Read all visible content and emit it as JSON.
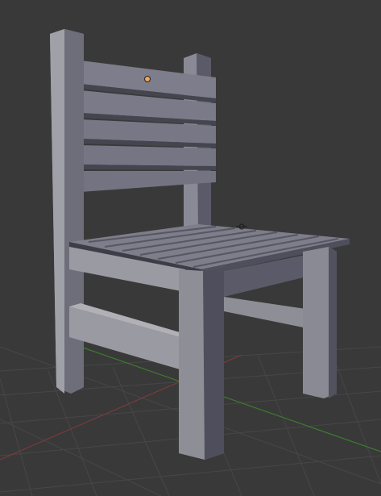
{
  "viewport": {
    "mode": "3d-viewport",
    "background_color": "#393939",
    "grid_color": "#474747",
    "x_axis_color": "#7a3b3b",
    "y_axis_color": "#3d7a2f"
  },
  "scene": {
    "object": "chair",
    "origin_marker_color": "#f2a65a",
    "mesh_light_color": "#8e8e96",
    "mesh_mid_color": "#72727c",
    "mesh_dark_color": "#4c4c5a",
    "mesh_shadow_color": "#34343e"
  }
}
